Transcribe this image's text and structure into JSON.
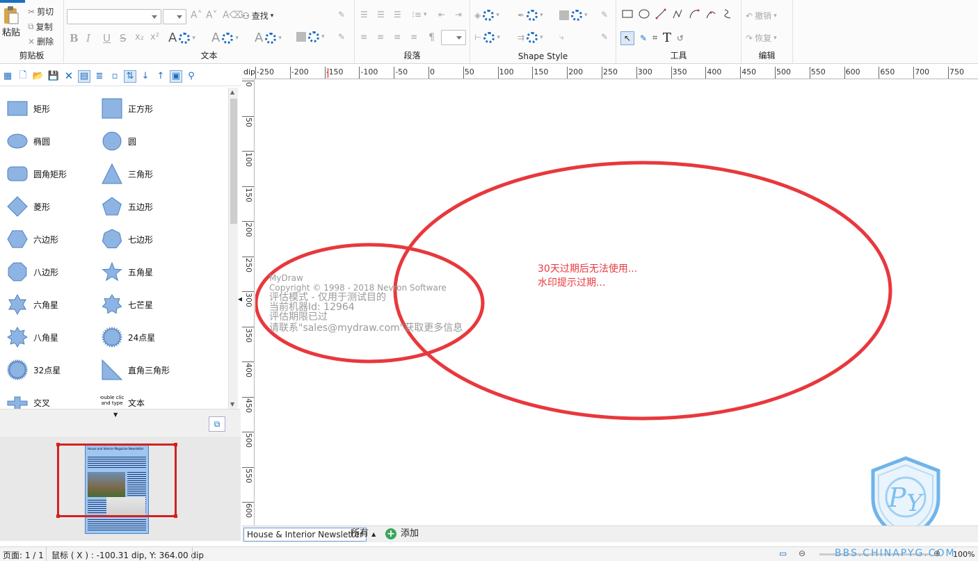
{
  "ribbon": {
    "clipboard": {
      "paste": "粘贴",
      "cut": "剪切",
      "copy": "复制",
      "delete": "删除",
      "group_label": "剪贴板"
    },
    "text": {
      "find": "查找",
      "group_label": "文本"
    },
    "paragraph": {
      "group_label": "段落"
    },
    "shape_style": {
      "group_label": "Shape Style"
    },
    "tools": {
      "group_label": "工具"
    },
    "edit": {
      "undo": "撤销",
      "redo": "恢复",
      "group_label": "编辑"
    }
  },
  "shapes": [
    {
      "label": "矩形",
      "icon": "rectangle"
    },
    {
      "label": "正方形",
      "icon": "square"
    },
    {
      "label": "椭圆",
      "icon": "ellipse"
    },
    {
      "label": "圆",
      "icon": "circle"
    },
    {
      "label": "圆角矩形",
      "icon": "rounded-rectangle"
    },
    {
      "label": "三角形",
      "icon": "triangle"
    },
    {
      "label": "菱形",
      "icon": "diamond"
    },
    {
      "label": "五边形",
      "icon": "pentagon"
    },
    {
      "label": "六边形",
      "icon": "hexagon"
    },
    {
      "label": "七边形",
      "icon": "heptagon"
    },
    {
      "label": "八边形",
      "icon": "octagon"
    },
    {
      "label": "五角星",
      "icon": "star-5"
    },
    {
      "label": "六角星",
      "icon": "star-6"
    },
    {
      "label": "七芒星",
      "icon": "star-7"
    },
    {
      "label": "八角星",
      "icon": "star-8"
    },
    {
      "label": "24点星",
      "icon": "star-24"
    },
    {
      "label": "32点星",
      "icon": "star-32"
    },
    {
      "label": "直角三角形",
      "icon": "right-triangle"
    },
    {
      "label": "交叉",
      "icon": "cross"
    },
    {
      "label": "文本",
      "icon": "text"
    }
  ],
  "text_shape_preview": "Double click and type",
  "thumbnail": {
    "title": "House and Interior Magazine Newsletter"
  },
  "ruler": {
    "unit": "dip",
    "top_ticks": [
      "-250",
      "-200",
      "-150",
      "-100",
      "-50",
      "0",
      "50",
      "100",
      "150",
      "200",
      "250",
      "300",
      "350",
      "400",
      "450",
      "500",
      "550",
      "600",
      "650",
      "700",
      "750"
    ],
    "left_ticks": [
      "0",
      "50",
      "100",
      "150",
      "200",
      "250",
      "300",
      "350",
      "400",
      "450",
      "500",
      "550",
      "600"
    ]
  },
  "canvas": {
    "watermark": {
      "line1": "MyDraw",
      "line2": "Copyright © 1998 - 2018 Nevron Software",
      "line3": "评估模式 - 仅用于测试目的",
      "line4": "当前机器Id: 12964",
      "line5": "评估期限已过",
      "line6": "请联系\"sales@mydraw.com\"获取更多信息"
    },
    "annotation": {
      "line1": "30天过期后无法使用...",
      "line2": "水印提示过期..."
    },
    "annotation_color": "#e8383d"
  },
  "tabs": {
    "active_tab": "House & Interior Newsletter",
    "all_label": "所有",
    "add_label": "添加"
  },
  "status": {
    "page": "页面: 1 / 1",
    "mouse": "鼠标 ( X ) : -100.31 dip, Y: 364.00 dip",
    "zoom": "100%"
  },
  "watermark_logo": {
    "text": "BBS.CHINAPYG.COM"
  },
  "colors": {
    "accent": "#1e6fc0",
    "shape_fill": "#8db4e2",
    "shape_stroke": "#4f81bd"
  }
}
